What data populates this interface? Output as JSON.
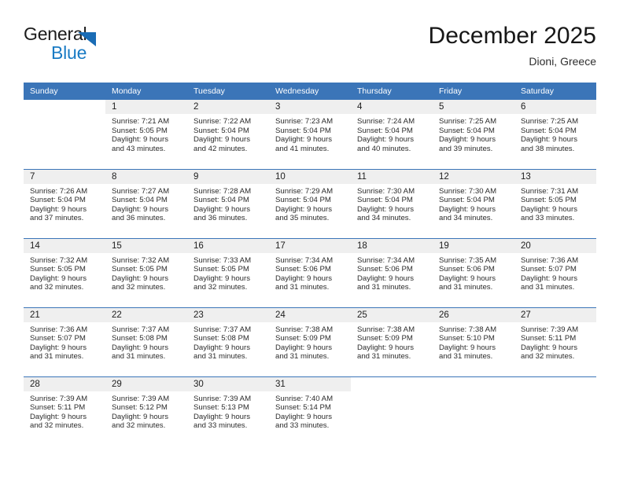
{
  "brand": {
    "name_part1": "General",
    "name_part2": "Blue",
    "triangle_color": "#1a6cb5",
    "blue_color": "#1a7bc4"
  },
  "header": {
    "month_title": "December 2025",
    "location": "Dioni, Greece"
  },
  "theme": {
    "header_bar_color": "#3b75b8",
    "daynum_band_color": "#efefef",
    "row_separator_color": "#3b75b8",
    "text_color": "#2b2b2b"
  },
  "weekday_headers": [
    "Sunday",
    "Monday",
    "Tuesday",
    "Wednesday",
    "Thursday",
    "Friday",
    "Saturday"
  ],
  "weeks": [
    [
      {
        "day": "",
        "blank": true
      },
      {
        "day": "1",
        "sunrise": "Sunrise: 7:21 AM",
        "sunset": "Sunset: 5:05 PM",
        "daylight1": "Daylight: 9 hours",
        "daylight2": "and 43 minutes."
      },
      {
        "day": "2",
        "sunrise": "Sunrise: 7:22 AM",
        "sunset": "Sunset: 5:04 PM",
        "daylight1": "Daylight: 9 hours",
        "daylight2": "and 42 minutes."
      },
      {
        "day": "3",
        "sunrise": "Sunrise: 7:23 AM",
        "sunset": "Sunset: 5:04 PM",
        "daylight1": "Daylight: 9 hours",
        "daylight2": "and 41 minutes."
      },
      {
        "day": "4",
        "sunrise": "Sunrise: 7:24 AM",
        "sunset": "Sunset: 5:04 PM",
        "daylight1": "Daylight: 9 hours",
        "daylight2": "and 40 minutes."
      },
      {
        "day": "5",
        "sunrise": "Sunrise: 7:25 AM",
        "sunset": "Sunset: 5:04 PM",
        "daylight1": "Daylight: 9 hours",
        "daylight2": "and 39 minutes."
      },
      {
        "day": "6",
        "sunrise": "Sunrise: 7:25 AM",
        "sunset": "Sunset: 5:04 PM",
        "daylight1": "Daylight: 9 hours",
        "daylight2": "and 38 minutes."
      }
    ],
    [
      {
        "day": "7",
        "sunrise": "Sunrise: 7:26 AM",
        "sunset": "Sunset: 5:04 PM",
        "daylight1": "Daylight: 9 hours",
        "daylight2": "and 37 minutes."
      },
      {
        "day": "8",
        "sunrise": "Sunrise: 7:27 AM",
        "sunset": "Sunset: 5:04 PM",
        "daylight1": "Daylight: 9 hours",
        "daylight2": "and 36 minutes."
      },
      {
        "day": "9",
        "sunrise": "Sunrise: 7:28 AM",
        "sunset": "Sunset: 5:04 PM",
        "daylight1": "Daylight: 9 hours",
        "daylight2": "and 36 minutes."
      },
      {
        "day": "10",
        "sunrise": "Sunrise: 7:29 AM",
        "sunset": "Sunset: 5:04 PM",
        "daylight1": "Daylight: 9 hours",
        "daylight2": "and 35 minutes."
      },
      {
        "day": "11",
        "sunrise": "Sunrise: 7:30 AM",
        "sunset": "Sunset: 5:04 PM",
        "daylight1": "Daylight: 9 hours",
        "daylight2": "and 34 minutes."
      },
      {
        "day": "12",
        "sunrise": "Sunrise: 7:30 AM",
        "sunset": "Sunset: 5:04 PM",
        "daylight1": "Daylight: 9 hours",
        "daylight2": "and 34 minutes."
      },
      {
        "day": "13",
        "sunrise": "Sunrise: 7:31 AM",
        "sunset": "Sunset: 5:05 PM",
        "daylight1": "Daylight: 9 hours",
        "daylight2": "and 33 minutes."
      }
    ],
    [
      {
        "day": "14",
        "sunrise": "Sunrise: 7:32 AM",
        "sunset": "Sunset: 5:05 PM",
        "daylight1": "Daylight: 9 hours",
        "daylight2": "and 32 minutes."
      },
      {
        "day": "15",
        "sunrise": "Sunrise: 7:32 AM",
        "sunset": "Sunset: 5:05 PM",
        "daylight1": "Daylight: 9 hours",
        "daylight2": "and 32 minutes."
      },
      {
        "day": "16",
        "sunrise": "Sunrise: 7:33 AM",
        "sunset": "Sunset: 5:05 PM",
        "daylight1": "Daylight: 9 hours",
        "daylight2": "and 32 minutes."
      },
      {
        "day": "17",
        "sunrise": "Sunrise: 7:34 AM",
        "sunset": "Sunset: 5:06 PM",
        "daylight1": "Daylight: 9 hours",
        "daylight2": "and 31 minutes."
      },
      {
        "day": "18",
        "sunrise": "Sunrise: 7:34 AM",
        "sunset": "Sunset: 5:06 PM",
        "daylight1": "Daylight: 9 hours",
        "daylight2": "and 31 minutes."
      },
      {
        "day": "19",
        "sunrise": "Sunrise: 7:35 AM",
        "sunset": "Sunset: 5:06 PM",
        "daylight1": "Daylight: 9 hours",
        "daylight2": "and 31 minutes."
      },
      {
        "day": "20",
        "sunrise": "Sunrise: 7:36 AM",
        "sunset": "Sunset: 5:07 PM",
        "daylight1": "Daylight: 9 hours",
        "daylight2": "and 31 minutes."
      }
    ],
    [
      {
        "day": "21",
        "sunrise": "Sunrise: 7:36 AM",
        "sunset": "Sunset: 5:07 PM",
        "daylight1": "Daylight: 9 hours",
        "daylight2": "and 31 minutes."
      },
      {
        "day": "22",
        "sunrise": "Sunrise: 7:37 AM",
        "sunset": "Sunset: 5:08 PM",
        "daylight1": "Daylight: 9 hours",
        "daylight2": "and 31 minutes."
      },
      {
        "day": "23",
        "sunrise": "Sunrise: 7:37 AM",
        "sunset": "Sunset: 5:08 PM",
        "daylight1": "Daylight: 9 hours",
        "daylight2": "and 31 minutes."
      },
      {
        "day": "24",
        "sunrise": "Sunrise: 7:38 AM",
        "sunset": "Sunset: 5:09 PM",
        "daylight1": "Daylight: 9 hours",
        "daylight2": "and 31 minutes."
      },
      {
        "day": "25",
        "sunrise": "Sunrise: 7:38 AM",
        "sunset": "Sunset: 5:09 PM",
        "daylight1": "Daylight: 9 hours",
        "daylight2": "and 31 minutes."
      },
      {
        "day": "26",
        "sunrise": "Sunrise: 7:38 AM",
        "sunset": "Sunset: 5:10 PM",
        "daylight1": "Daylight: 9 hours",
        "daylight2": "and 31 minutes."
      },
      {
        "day": "27",
        "sunrise": "Sunrise: 7:39 AM",
        "sunset": "Sunset: 5:11 PM",
        "daylight1": "Daylight: 9 hours",
        "daylight2": "and 32 minutes."
      }
    ],
    [
      {
        "day": "28",
        "sunrise": "Sunrise: 7:39 AM",
        "sunset": "Sunset: 5:11 PM",
        "daylight1": "Daylight: 9 hours",
        "daylight2": "and 32 minutes."
      },
      {
        "day": "29",
        "sunrise": "Sunrise: 7:39 AM",
        "sunset": "Sunset: 5:12 PM",
        "daylight1": "Daylight: 9 hours",
        "daylight2": "and 32 minutes."
      },
      {
        "day": "30",
        "sunrise": "Sunrise: 7:39 AM",
        "sunset": "Sunset: 5:13 PM",
        "daylight1": "Daylight: 9 hours",
        "daylight2": "and 33 minutes."
      },
      {
        "day": "31",
        "sunrise": "Sunrise: 7:40 AM",
        "sunset": "Sunset: 5:14 PM",
        "daylight1": "Daylight: 9 hours",
        "daylight2": "and 33 minutes."
      },
      {
        "day": "",
        "blank": true
      },
      {
        "day": "",
        "blank": true
      },
      {
        "day": "",
        "blank": true
      }
    ]
  ]
}
